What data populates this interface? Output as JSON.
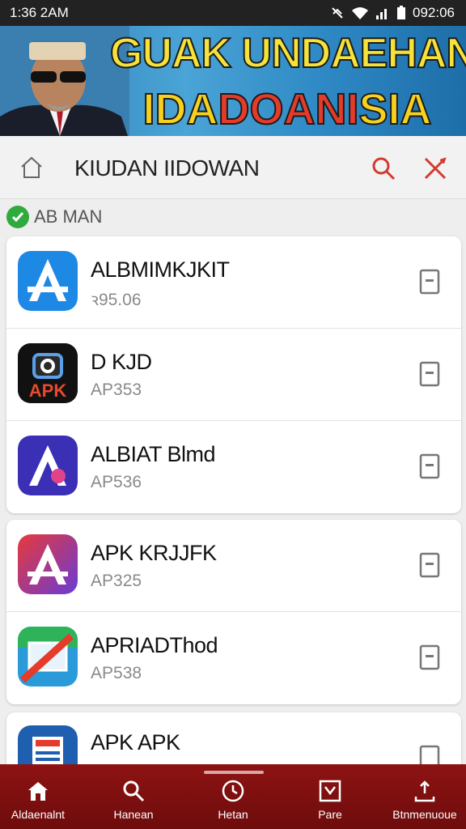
{
  "status_bar": {
    "time_left": "1:36 2AM",
    "time_right": "092:06"
  },
  "banner": {
    "line1": "GUAK UNDAEHAN",
    "line2_a": "IDA",
    "line2_b": "DOANI",
    "line2_c": "SIA"
  },
  "header": {
    "title": "KIUDAN IIDOWAN"
  },
  "section": {
    "label": "AB MAN"
  },
  "apps": [
    {
      "name": "ALBMIMKJKIT",
      "version": "ꝛ95.06",
      "icon": "app-icon-blue-a"
    },
    {
      "name": "D KJD",
      "version": "AP353",
      "icon": "app-icon-apk-black",
      "icon_text": "APK"
    },
    {
      "name": "ALBIAT Blmd",
      "version": "AP536",
      "icon": "app-icon-indigo-a"
    },
    {
      "name": "APK KRJJFK",
      "version": "AP325",
      "icon": "app-icon-gradient-a"
    },
    {
      "name": "APRIADThod",
      "version": "AP538",
      "icon": "app-icon-green-slash"
    },
    {
      "name": "APK APK",
      "version": "",
      "icon": "app-icon-blue-doc"
    }
  ],
  "bottom_nav": [
    {
      "label": "Aldaenalnt",
      "icon": "home-icon"
    },
    {
      "label": "Hanean",
      "icon": "search-icon"
    },
    {
      "label": "Hetan",
      "icon": "clock-icon"
    },
    {
      "label": "Pare",
      "icon": "download-box-icon"
    },
    {
      "label": "Btnmenuoue",
      "icon": "upload-icon"
    }
  ],
  "colors": {
    "accent_red": "#d23b2f",
    "nav_bg": "#7e1010",
    "check_green": "#2eaa3e"
  }
}
